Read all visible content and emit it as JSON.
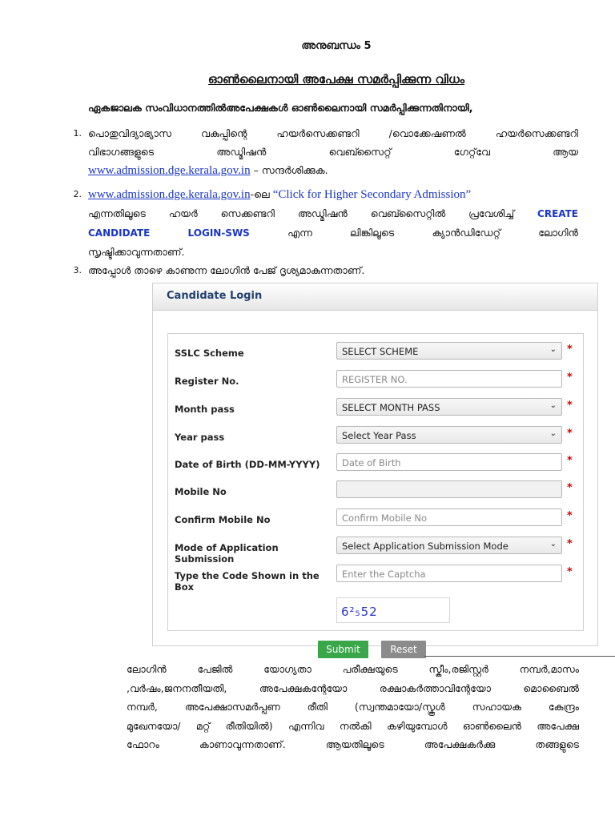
{
  "annex": "അനുബന്ധം 5",
  "title": "ഓൺലൈനായി അപേക്ഷ സമർപ്പിക്കുന്ന വിധം",
  "intro": "ഏകജാലക സംവിധാനത്തിൽഅപേക്ഷകൾ ഓൺലൈനായി സമർപ്പിക്കുന്നതിനായി,",
  "steps": [
    {
      "num": "1.",
      "line1": "പൊതുവിദ്യാഭ്യാസ വകുപ്പിന്റെ ഹയർസെക്കണ്ടറി /വൊക്കേഷണൽ ഹയർസെക്കണ്ടറി",
      "line2": "വിഭാഗങ്ങളുടെ അഡ്മിഷൻ വെബ്സൈറ്റ് ഗേറ്റ്‌വേ ആയ",
      "link": "www.admission.dge.kerala.gov.in",
      "after": " – സന്ദർശിക്കുക."
    },
    {
      "num": "2.",
      "link": "www.admission.dge.kerala.gov.in",
      "suffix": "-ലെ ",
      "quote": "“Click for Higher Secondary Admission”",
      "line2a": "എന്നതിലൂടെ ഹയർ സെക്കണ്ടറി അഡ്മിഷൻ വെബ്സൈറ്റിൽ പ്രവേശിച്ച്",
      "kw1": "CREATE",
      "kw2a": "CANDIDATE",
      "kw2b": "LOGIN-SWS",
      "line3b": "എന്ന ലിങ്കിലൂടെ ക്യാൻഡിഡേറ്റ് ലോഗിൻ",
      "line4": "സൃഷ്ടിക്കാവുന്നതാണ്."
    },
    {
      "num": "3.",
      "text": "അപ്പോൾ താഴെ കാണുന്ന ലോഗിൻ പേജ് ദൃശ്യമാകുന്നതാണ്."
    }
  ],
  "login": {
    "header": "Candidate Login",
    "fields": [
      {
        "label": "SSLC Scheme",
        "value": "SELECT SCHEME",
        "kind": "select",
        "required": "*"
      },
      {
        "label": "Register No.",
        "value": "REGISTER NO.",
        "kind": "placeholder",
        "required": "*"
      },
      {
        "label": "Month pass",
        "value": "SELECT MONTH PASS",
        "kind": "select",
        "required": "*"
      },
      {
        "label": "Year pass",
        "value": "Select Year Pass",
        "kind": "select",
        "required": "*"
      },
      {
        "label": "Date of Birth (DD-MM-YYYY)",
        "value": "Date of Birth",
        "kind": "placeholder",
        "required": "*"
      },
      {
        "label": "Mobile No",
        "value": "",
        "kind": "empty",
        "required": "*"
      },
      {
        "label": "Confirm Mobile No",
        "value": "Confirm Mobile No",
        "kind": "placeholder",
        "required": "*"
      },
      {
        "label": "Mode of Application Submission",
        "value": "Select Application Submission Mode",
        "kind": "select",
        "required": "*"
      },
      {
        "label": "Type the Code Shown in the Box",
        "value": "Enter the Captcha",
        "kind": "placeholder",
        "required": "*"
      }
    ],
    "captcha": "6²₅52",
    "submit_label": "Submit",
    "reset_label": "Reset"
  },
  "closing_lines": [
    "ലോഗിൻ പേജിൽ യോഗ്യതാ പരീക്ഷയുടെ സ്കീം,രജിസ്റ്റർ നമ്പർ,മാസം",
    ",വർഷം,ജനനതീയതി, അപേക്ഷകന്റേയോ രക്ഷാകർത്താവിന്റേയോ മൊബൈൽ",
    "നമ്പർ, അപേക്ഷാസമർപ്പണ രീതി (സ്വന്തമായോ/സ്കൂൾ സഹായക കേന്ദ്രം",
    "മുഖേനയോ/ മറ്റ് രീതിയിൽ) എന്നിവ നൽകി കഴിയുമ്പോൾ ഓൺലൈൻ അപേക്ഷ",
    "ഫോറം കാണാവുന്നതാണ്. ആയതിലൂടെ അപേക്ഷകർക്കു തങ്ങളുടെ"
  ]
}
